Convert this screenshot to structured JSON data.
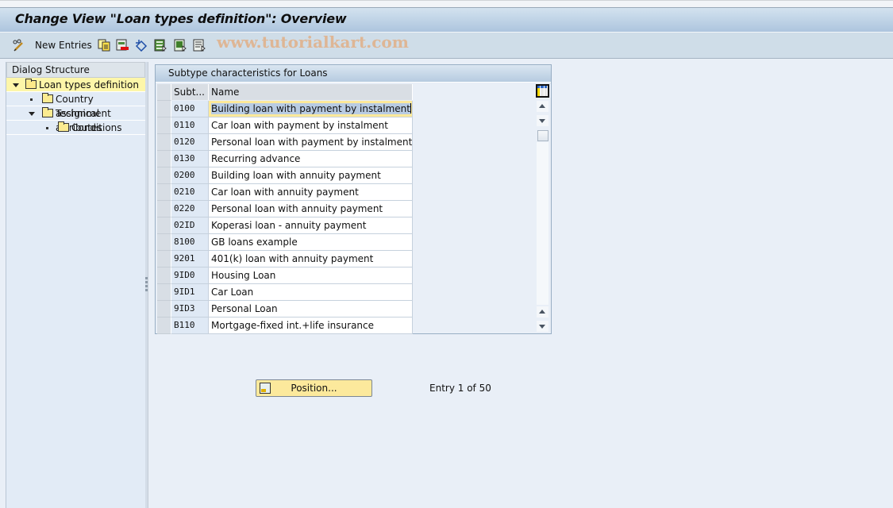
{
  "title": "Change View \"Loan types definition\": Overview",
  "toolbar": {
    "new_entries_label": "New Entries",
    "icons": [
      "pencil-glasses-icon",
      "copy-icon",
      "delete-icon",
      "undo-icon",
      "select-all-icon",
      "select-block-icon",
      "deselect-all-icon"
    ],
    "watermark": "www.tutorialkart.com"
  },
  "dialog_structure": {
    "header": "Dialog Structure",
    "items": [
      {
        "label": "Loan types definition",
        "level": 0,
        "expander": "expanded",
        "selected": true
      },
      {
        "label": "Country assignment",
        "level": 1,
        "expander": "leaf",
        "selected": false
      },
      {
        "label": "Technical attributes",
        "level": 1,
        "expander": "expanded",
        "selected": false
      },
      {
        "label": "Conditions",
        "level": 2,
        "expander": "leaf",
        "selected": false
      }
    ]
  },
  "table": {
    "title": "Subtype characteristics for Loans",
    "columns": [
      "Subt...",
      "Name"
    ],
    "rows": [
      {
        "code": "0100",
        "name": "Building loan with payment by instalment"
      },
      {
        "code": "0110",
        "name": "Car loan with payment by instalment"
      },
      {
        "code": "0120",
        "name": "Personal loan with payment by instalment"
      },
      {
        "code": "0130",
        "name": "Recurring advance"
      },
      {
        "code": "0200",
        "name": "Building loan with annuity payment"
      },
      {
        "code": "0210",
        "name": "Car loan with annuity payment"
      },
      {
        "code": "0220",
        "name": "Personal loan with annuity payment"
      },
      {
        "code": "02ID",
        "name": "Koperasi loan - annuity payment"
      },
      {
        "code": "8100",
        "name": "GB loans example"
      },
      {
        "code": "9201",
        "name": "401(k) loan with annuity payment"
      },
      {
        "code": "9ID0",
        "name": "Housing Loan"
      },
      {
        "code": "9ID1",
        "name": "Car Loan"
      },
      {
        "code": "9ID3",
        "name": "Personal Loan"
      },
      {
        "code": "B110",
        "name": "Mortgage-fixed int.+life insurance"
      }
    ]
  },
  "footer": {
    "position_button": "Position...",
    "entry_info": "Entry 1 of 50"
  }
}
